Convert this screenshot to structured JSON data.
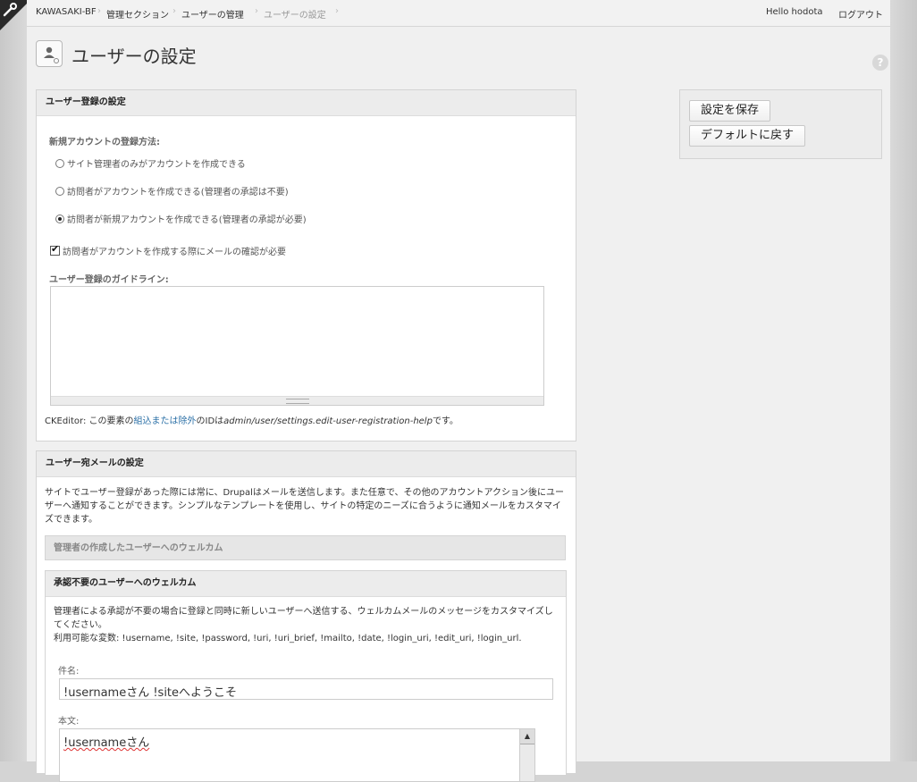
{
  "breadcrumb": {
    "items": [
      "KAWASAKI-BF",
      "管理セクション",
      "ユーザーの管理",
      "ユーザーの設定"
    ]
  },
  "user_menu": {
    "greeting": "Hello hodota",
    "logout": "ログアウト"
  },
  "page": {
    "title": "ユーザーの設定",
    "help": "?"
  },
  "registration": {
    "heading": "ユーザー登録の設定",
    "method_label": "新規アカウントの登録方法:",
    "options": [
      {
        "label": "サイト管理者のみがアカウントを作成できる",
        "selected": false
      },
      {
        "label": "訪問者がアカウントを作成できる(管理者の承認は不要)",
        "selected": false
      },
      {
        "label": "訪問者が新規アカウントを作成できる(管理者の承認が必要)",
        "selected": true
      }
    ],
    "email_verification": {
      "label": "訪問者がアカウントを作成する際にメールの確認が必要",
      "checked": true
    },
    "guideline_label": "ユーザー登録のガイドライン:",
    "ckeditor_note": {
      "prefix": "CKEditor: この要素の",
      "link": "組込または除外",
      "middle": "のIDは",
      "id": "admin/user/settings.edit-user-registration-help",
      "suffix": "です。"
    }
  },
  "email": {
    "heading": "ユーザー宛メールの設定",
    "description": "サイトでユーザー登録があった際には常に、Drupalはメールを送信します。また任意で、その他のアカウントアクション後にユーザーへ通知することができます。シンプルなテンプレートを使用し、サイトの特定のニーズに合うように通知メールをカスタマイズできます。",
    "admin_created_heading": "管理者の作成したユーザーへのウェルカム",
    "no_approval": {
      "heading": "承認不要のユーザーへのウェルカム",
      "description": "管理者による承認が不要の場合に登録と同時に新しいユーザーへ送信する、ウェルカムメールのメッセージをカスタマイズしてください。",
      "variables": "利用可能な変数: !username, !site, !password, !uri, !uri_brief, !mailto, !date, !login_uri, !edit_uri, !login_url.",
      "subject_label": "件名:",
      "subject_value": "!usernameさん !siteへようこそ",
      "body_label": "本文:",
      "body_value": "!usernameさん"
    }
  },
  "actions": {
    "save": "設定を保存",
    "reset": "デフォルトに戻す"
  }
}
